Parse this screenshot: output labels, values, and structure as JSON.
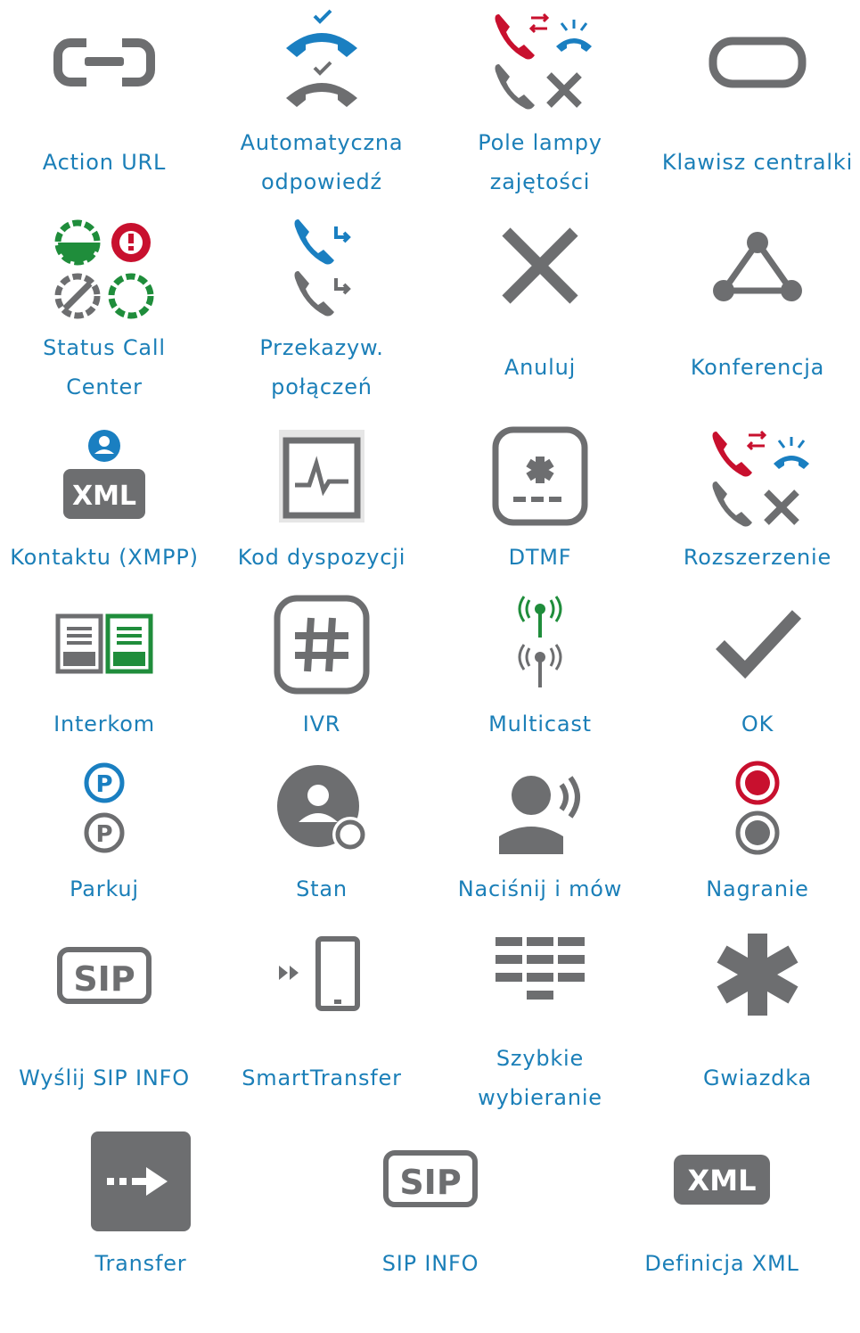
{
  "colors": {
    "label": "#1b7fb8",
    "icon_gray": "#6d6e70",
    "accent_blue": "#1a7fc1",
    "accent_red": "#c8102e",
    "accent_green": "#1f8d3b"
  },
  "items": [
    {
      "label": "Action URL",
      "icon": "link-icon"
    },
    {
      "label": "Automatyczna\nodpowiedź",
      "icon": "auto-answer-icon"
    },
    {
      "label": "Pole lampy\nzajętości",
      "icon": "busy-lamp-field-icon"
    },
    {
      "label": "Klawisz centralki",
      "icon": "pbx-key-icon"
    },
    {
      "label": "Status Call\nCenter",
      "icon": "call-center-status-icon"
    },
    {
      "label": "Przekazyw.\npołączeń",
      "icon": "call-forward-icon"
    },
    {
      "label": "Anuluj",
      "icon": "cancel-icon"
    },
    {
      "label": "Konferencja",
      "icon": "conference-icon"
    },
    {
      "label": "Kontaktu (XMPP)",
      "icon": "xmpp-contact-icon"
    },
    {
      "label": "Kod dyspozycji",
      "icon": "disposition-code-icon"
    },
    {
      "label": "DTMF",
      "icon": "dtmf-icon"
    },
    {
      "label": "Rozszerzenie",
      "icon": "extension-icon"
    },
    {
      "label": "Interkom",
      "icon": "intercom-icon"
    },
    {
      "label": "IVR",
      "icon": "ivr-icon"
    },
    {
      "label": "Multicast",
      "icon": "multicast-icon"
    },
    {
      "label": "OK",
      "icon": "ok-check-icon"
    },
    {
      "label": "Parkuj",
      "icon": "park-icon"
    },
    {
      "label": "Stan",
      "icon": "presence-status-icon"
    },
    {
      "label": "Naciśnij i mów",
      "icon": "push-to-talk-icon"
    },
    {
      "label": "Nagranie",
      "icon": "record-icon"
    },
    {
      "label": "Wyślij SIP INFO",
      "icon": "send-sip-info-icon"
    },
    {
      "label": "SmartTransfer",
      "icon": "smart-transfer-icon"
    },
    {
      "label": "Szybkie\nwybieranie",
      "icon": "speed-dial-icon"
    },
    {
      "label": "Gwiazdka",
      "icon": "star-code-icon"
    },
    {
      "label": "Transfer",
      "icon": "transfer-icon"
    },
    {
      "label": "SIP INFO",
      "icon": "sip-info-icon"
    },
    {
      "label": "Definicja XML",
      "icon": "xml-definition-icon"
    }
  ]
}
